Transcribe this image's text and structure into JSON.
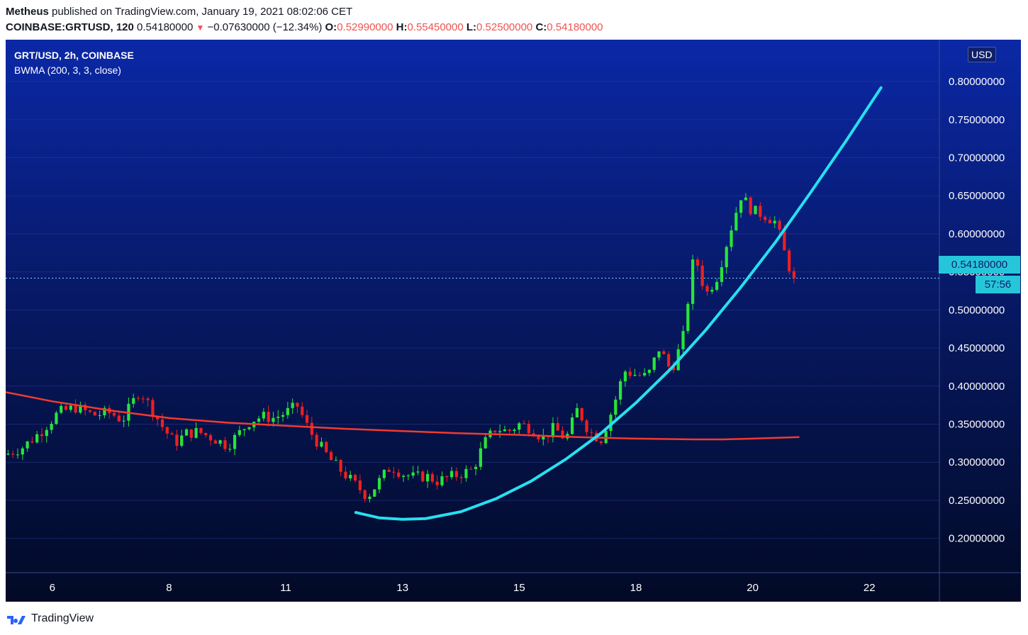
{
  "header": {
    "author": "Metheus",
    "published_text": "published on TradingView.com, January 19, 2021 08:02:06 CET",
    "symbol": "COINBASE:GRTUSD, 120",
    "last": "0.54180000",
    "change": "−0.07630000 (−12.34%)",
    "o_label": "O:",
    "o_value": "0.52990000",
    "h_label": "H:",
    "h_value": "0.55450000",
    "l_label": "L:",
    "l_value": "0.52500000",
    "c_label": "C:",
    "c_value": "0.54180000"
  },
  "legend": {
    "title": "GRT/USD, 2h, COINBASE",
    "indicator": "BWMA (200, 3, 3, close)"
  },
  "axis": {
    "currency": "USD",
    "price_tag": "0.54180000",
    "countdown": "57:56"
  },
  "footer": {
    "brand": "TradingView"
  },
  "colors": {
    "bg_top": "#0b28a6",
    "bg_bottom": "#020a26",
    "up": "#26e53a",
    "down": "#ef1f1f",
    "bwma": "#f23a30",
    "projection": "#26e0f0",
    "tag": "#26c6da"
  },
  "chart_data": {
    "type": "candlestick",
    "title": "GRT/USD, 2h, COINBASE",
    "y_ticks": [
      "0.20000000",
      "0.25000000",
      "0.30000000",
      "0.35000000",
      "0.40000000",
      "0.45000000",
      "0.50000000",
      "0.55000000",
      "0.60000000",
      "0.65000000",
      "0.70000000",
      "0.75000000",
      "0.80000000"
    ],
    "y_range": [
      0.155,
      0.855
    ],
    "x_ticks": [
      "6",
      "8",
      "11",
      "13",
      "15",
      "18",
      "20",
      "22"
    ],
    "x_tick_days": [
      6,
      8,
      10,
      12,
      14,
      16,
      18,
      20
    ],
    "x_range": [
      5.2,
      21.2
    ],
    "last_price": 0.5418,
    "price_path": [
      [
        5.2,
        0.31
      ],
      [
        5.5,
        0.32
      ],
      [
        5.8,
        0.34
      ],
      [
        6.1,
        0.365
      ],
      [
        6.4,
        0.372
      ],
      [
        6.7,
        0.362
      ],
      [
        7.0,
        0.365
      ],
      [
        7.2,
        0.355
      ],
      [
        7.5,
        0.395
      ],
      [
        7.7,
        0.37
      ],
      [
        7.9,
        0.345
      ],
      [
        8.1,
        0.325
      ],
      [
        8.3,
        0.338
      ],
      [
        8.5,
        0.34
      ],
      [
        8.8,
        0.33
      ],
      [
        9.0,
        0.322
      ],
      [
        9.2,
        0.338
      ],
      [
        9.4,
        0.355
      ],
      [
        9.6,
        0.36
      ],
      [
        9.8,
        0.358
      ],
      [
        10.0,
        0.365
      ],
      [
        10.2,
        0.374
      ],
      [
        10.4,
        0.342
      ],
      [
        10.6,
        0.32
      ],
      [
        10.8,
        0.3
      ],
      [
        11.0,
        0.285
      ],
      [
        11.2,
        0.27
      ],
      [
        11.4,
        0.255
      ],
      [
        11.6,
        0.275
      ],
      [
        11.8,
        0.295
      ],
      [
        12.0,
        0.285
      ],
      [
        12.2,
        0.28
      ],
      [
        12.4,
        0.282
      ],
      [
        12.6,
        0.275
      ],
      [
        12.8,
        0.28
      ],
      [
        13.0,
        0.285
      ],
      [
        13.2,
        0.29
      ],
      [
        13.4,
        0.325
      ],
      [
        13.6,
        0.345
      ],
      [
        13.8,
        0.34
      ],
      [
        14.0,
        0.35
      ],
      [
        14.2,
        0.345
      ],
      [
        14.4,
        0.332
      ],
      [
        14.6,
        0.345
      ],
      [
        14.8,
        0.33
      ],
      [
        15.0,
        0.37
      ],
      [
        15.2,
        0.34
      ],
      [
        15.4,
        0.33
      ],
      [
        15.6,
        0.37
      ],
      [
        15.8,
        0.42
      ],
      [
        16.0,
        0.415
      ],
      [
        16.2,
        0.412
      ],
      [
        16.4,
        0.45
      ],
      [
        16.6,
        0.42
      ],
      [
        16.8,
        0.46
      ],
      [
        17.0,
        0.575
      ],
      [
        17.2,
        0.52
      ],
      [
        17.4,
        0.545
      ],
      [
        17.6,
        0.6
      ],
      [
        17.8,
        0.65
      ],
      [
        18.0,
        0.63
      ],
      [
        18.2,
        0.625
      ],
      [
        18.4,
        0.615
      ],
      [
        18.6,
        0.56
      ],
      [
        18.75,
        0.5418
      ]
    ],
    "series": [
      {
        "name": "BWMA (200, 3, 3, close)",
        "type": "line",
        "x": [
          5.2,
          6,
          7,
          8,
          9,
          10,
          11,
          12,
          13,
          14,
          15,
          16,
          17,
          17.5,
          18,
          18.8
        ],
        "y": [
          0.392,
          0.38,
          0.368,
          0.358,
          0.352,
          0.348,
          0.344,
          0.341,
          0.338,
          0.336,
          0.333,
          0.331,
          0.33,
          0.33,
          0.331,
          0.333
        ]
      },
      {
        "name": "projection",
        "type": "line",
        "x": [
          11.2,
          11.6,
          12.0,
          12.4,
          13,
          13.6,
          14.2,
          14.8,
          15.4,
          16.0,
          16.6,
          17.2,
          17.8,
          18.4,
          19.0,
          19.6,
          20.2
        ],
        "y": [
          0.234,
          0.227,
          0.225,
          0.226,
          0.235,
          0.252,
          0.275,
          0.304,
          0.338,
          0.378,
          0.423,
          0.474,
          0.53,
          0.59,
          0.655,
          0.722,
          0.792
        ]
      }
    ]
  }
}
